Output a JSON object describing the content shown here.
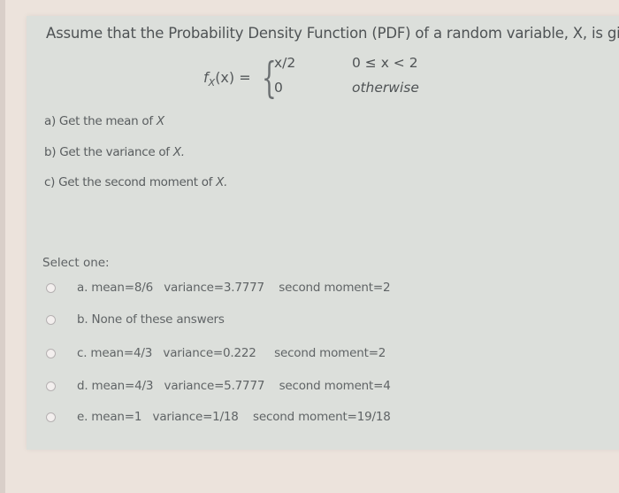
{
  "question": {
    "intro": "Assume that the Probability Density Function (PDF) of a random variable, X, is given by",
    "formula": {
      "lhs_f": "f",
      "lhs_sub": "X",
      "lhs_rest": "(x) =",
      "brace": "{",
      "cases": [
        {
          "value": "x/2",
          "condition": "0 ≤ x < 2"
        },
        {
          "value": "0",
          "condition": "otherwise"
        }
      ]
    },
    "subquestions": [
      {
        "prefix": "a) Get the mean of ",
        "var": "X"
      },
      {
        "prefix": "b) Get the variance of ",
        "var": "X."
      },
      {
        "prefix": "c) Get the second moment of ",
        "var": "X."
      }
    ]
  },
  "answer_block": {
    "select_label": "Select one:",
    "options": [
      {
        "id": "a",
        "text": "a. mean=8/6   variance=3.7777    second moment=2",
        "selected": false
      },
      {
        "id": "b",
        "text": "b. None of these answers",
        "selected": false
      },
      {
        "id": "c",
        "text": "c. mean=4/3   variance=0.222     second moment=2",
        "selected": false
      },
      {
        "id": "d",
        "text": "d. mean=4/3   variance=5.7777    second moment=4",
        "selected": false
      },
      {
        "id": "e",
        "text": "e. mean=1   variance=1/18    second moment=19/18",
        "selected": false
      }
    ]
  },
  "colors": {
    "page_background": "#ece3dc",
    "panel_background": "#dcdfdb",
    "text": "#4f5355",
    "radio_fill": "#f3efee"
  }
}
